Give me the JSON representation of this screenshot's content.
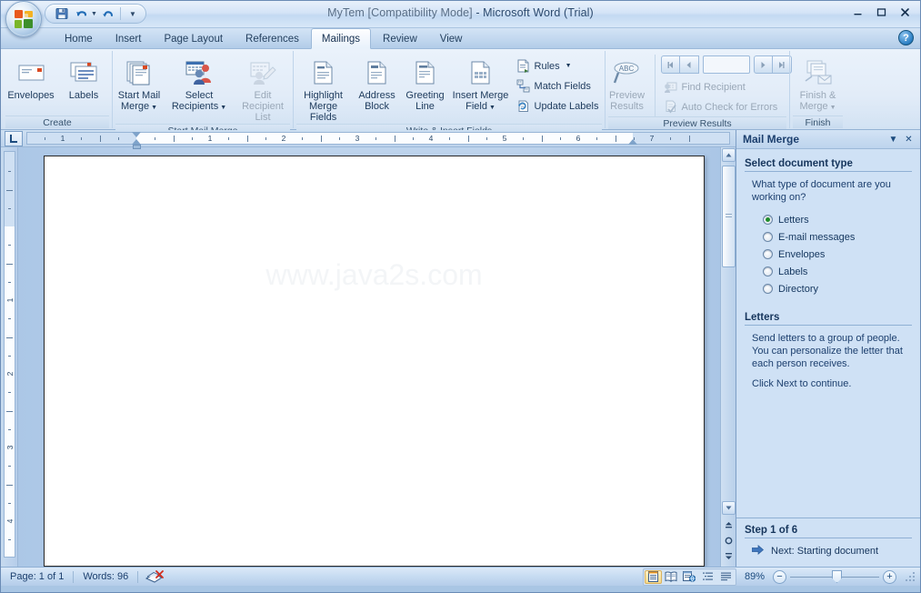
{
  "window": {
    "title_doc": "MyTem [Compatibility Mode]",
    "title_sep": " - ",
    "title_app": "Microsoft Word (Trial)",
    "minimize": "–",
    "maximize": "❐",
    "close": "✕"
  },
  "quick_access": {
    "save": "save-icon",
    "undo": "undo-icon",
    "redo": "redo-icon",
    "customize": "customize-icon"
  },
  "tabs": [
    {
      "label": "Home",
      "active": false
    },
    {
      "label": "Insert",
      "active": false
    },
    {
      "label": "Page Layout",
      "active": false
    },
    {
      "label": "References",
      "active": false
    },
    {
      "label": "Mailings",
      "active": true
    },
    {
      "label": "Review",
      "active": false
    },
    {
      "label": "View",
      "active": false
    }
  ],
  "help_button": "?",
  "ribbon": {
    "groups": [
      {
        "label": "Create",
        "buttons": [
          {
            "label": "Envelopes",
            "disabled": false
          },
          {
            "label": "Labels",
            "disabled": false
          }
        ]
      },
      {
        "label": "Start Mail Merge",
        "buttons": [
          {
            "label": "Start Mail\nMerge",
            "line1": "Start Mail",
            "line2": "Merge",
            "dropdown": true,
            "disabled": false
          },
          {
            "label": "Select\nRecipients",
            "line1": "Select",
            "line2": "Recipients",
            "dropdown": true,
            "disabled": false
          },
          {
            "label": "Edit\nRecipient List",
            "line1": "Edit",
            "line2": "Recipient List",
            "dropdown": false,
            "disabled": true
          }
        ]
      },
      {
        "label": "Write & Insert Fields",
        "buttons": [
          {
            "line1": "Highlight",
            "line2": "Merge Fields",
            "dropdown": false,
            "disabled": false
          },
          {
            "line1": "Address",
            "line2": "Block",
            "dropdown": false,
            "disabled": false
          },
          {
            "line1": "Greeting",
            "line2": "Line",
            "dropdown": false,
            "disabled": false
          },
          {
            "line1": "Insert Merge",
            "line2": "Field",
            "dropdown": true,
            "disabled": false
          }
        ],
        "small_buttons": [
          {
            "label": "Rules",
            "dropdown": true,
            "disabled": false
          },
          {
            "label": "Match Fields",
            "dropdown": false,
            "disabled": false
          },
          {
            "label": "Update Labels",
            "dropdown": false,
            "disabled": false
          }
        ]
      },
      {
        "label": "Preview Results",
        "buttons": [
          {
            "line1": "Preview",
            "line2": "Results",
            "dropdown": false,
            "disabled": false
          }
        ],
        "record_nav": {
          "first": "◀│",
          "prev": "◀",
          "value": "",
          "next": "▶",
          "last": "│▶"
        },
        "small_buttons": [
          {
            "label": "Find Recipient",
            "dropdown": false,
            "disabled": true
          },
          {
            "label": "Auto Check for Errors",
            "dropdown": false,
            "disabled": true
          }
        ]
      },
      {
        "label": "Finish",
        "buttons": [
          {
            "line1": "Finish &",
            "line2": "Merge",
            "dropdown": true,
            "disabled": false
          }
        ]
      }
    ]
  },
  "ruler": {
    "horizontal_numbers": [
      "1",
      "1",
      "2",
      "3",
      "4",
      "5",
      "6",
      "7"
    ],
    "vertical_numbers": [
      "1",
      "1",
      "2",
      "3",
      "4"
    ]
  },
  "document": {
    "watermark": "www.java2s.com"
  },
  "task_pane": {
    "title": "Mail Merge",
    "dropdown_icon": "▼",
    "close_icon": "✕",
    "section_title": "Select document type",
    "question": "What type of document are you working on?",
    "options": [
      {
        "label": "Letters",
        "selected": true
      },
      {
        "label": "E-mail messages",
        "selected": false
      },
      {
        "label": "Envelopes",
        "selected": false
      },
      {
        "label": "Labels",
        "selected": false
      },
      {
        "label": "Directory",
        "selected": false
      }
    ],
    "detail_title": "Letters",
    "detail_text_1": "Send letters to a group of people. You can personalize the letter that each person receives.",
    "detail_text_2": "Click Next to continue.",
    "step_label": "Step 1 of 6",
    "next_link": "Next: Starting document"
  },
  "status_bar": {
    "page": "Page: 1 of 1",
    "words": "Words: 96",
    "proofing_icon": "proofing-errors-icon",
    "views": [
      {
        "name": "print-layout-view",
        "active": true
      },
      {
        "name": "full-screen-reading-view",
        "active": false
      },
      {
        "name": "web-layout-view",
        "active": false
      },
      {
        "name": "outline-view",
        "active": false
      },
      {
        "name": "draft-view",
        "active": false
      }
    ],
    "zoom": "89%",
    "zoom_out": "−",
    "zoom_in": "+"
  }
}
